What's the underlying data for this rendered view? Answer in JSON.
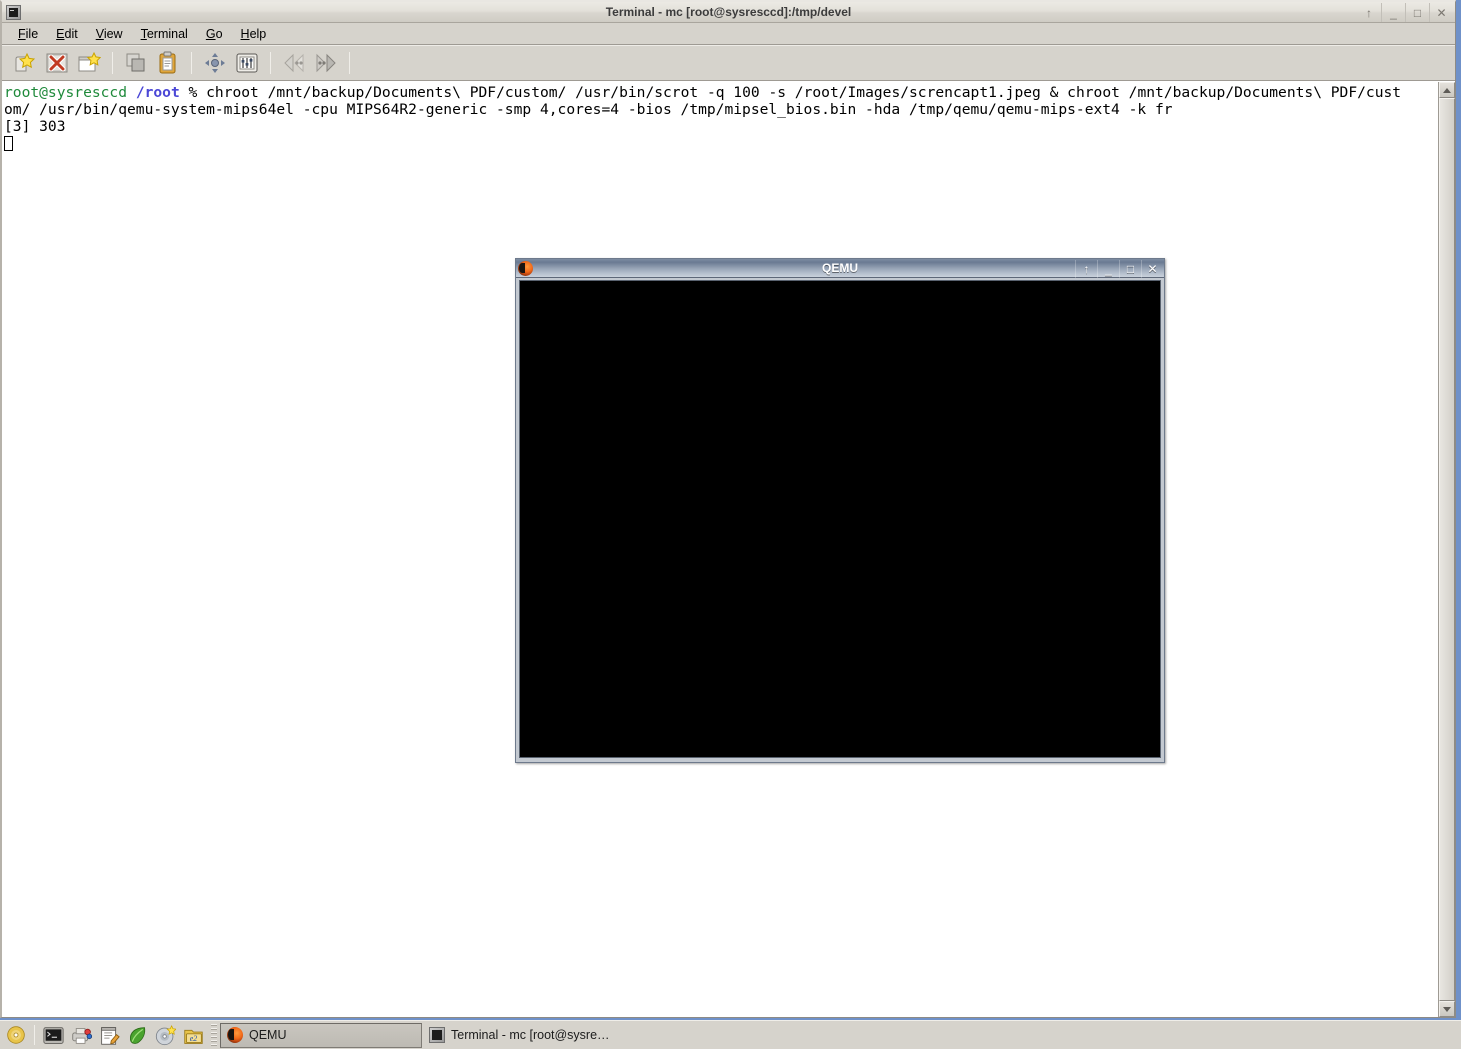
{
  "terminal_window": {
    "title": "Terminal - mc [root@sysresccd]:/tmp/devel",
    "icon": "terminal-icon",
    "window_buttons": [
      {
        "name": "shade-button",
        "glyph": "↑"
      },
      {
        "name": "minimize-button",
        "glyph": "_"
      },
      {
        "name": "maximize-button",
        "glyph": "□"
      },
      {
        "name": "close-button",
        "glyph": "✕"
      }
    ],
    "menu": [
      {
        "label": "File",
        "mnemonic": "F"
      },
      {
        "label": "Edit",
        "mnemonic": "E"
      },
      {
        "label": "View",
        "mnemonic": "V"
      },
      {
        "label": "Terminal",
        "mnemonic": "T"
      },
      {
        "label": "Go",
        "mnemonic": "G"
      },
      {
        "label": "Help",
        "mnemonic": "H"
      }
    ],
    "toolbar": [
      {
        "name": "new-tab-button",
        "icon": "new-tab-star-icon"
      },
      {
        "name": "close-tab-button",
        "icon": "close-tab-x-icon"
      },
      {
        "name": "new-window-button",
        "icon": "new-window-star-icon"
      },
      {
        "name": "separator-1",
        "icon": "separator"
      },
      {
        "name": "copy-button",
        "icon": "copy-icon"
      },
      {
        "name": "paste-button",
        "icon": "clipboard-paste-icon"
      },
      {
        "name": "separator-2",
        "icon": "separator"
      },
      {
        "name": "move-tab-button",
        "icon": "move-arrows-icon"
      },
      {
        "name": "preferences-button",
        "icon": "settings-sliders-icon"
      },
      {
        "name": "separator-3",
        "icon": "separator"
      },
      {
        "name": "previous-tab-button",
        "icon": "back-arrow-icon"
      },
      {
        "name": "next-tab-button",
        "icon": "forward-arrow-icon"
      },
      {
        "name": "separator-4",
        "icon": "separator"
      }
    ],
    "colors": {
      "prompt_user": "#1f8a3b",
      "prompt_path": "#4b47d6",
      "text": "#000000",
      "background": "#ffffff",
      "chrome": "#d6d3cc",
      "desktop": "#6f91c9"
    },
    "console": {
      "prompt_user": "root@sysresccd",
      "prompt_path": "/root",
      "prompt_symbol": "%",
      "command_part1": " chroot /mnt/backup/Documents\\ PDF/custom/ /usr/bin/scrot -q 100 -s /root/Images/screncapt1.jpeg & chroot /mnt/backup/Documents\\ PDF/cust",
      "command_part2": "om/ /usr/bin/qemu-system-mips64el -cpu MIPS64R2-generic -smp 4,cores=4 -bios /tmp/mipsel_bios.bin -hda /tmp/qemu/qemu-mips-ext4 -k fr",
      "job_output": "[3] 303",
      "cursor": "block-cursor"
    },
    "scrollbar": {
      "up_arrow": "scroll-up-arrow",
      "down_arrow": "scroll-down-arrow",
      "thumb": "scroll-thumb"
    }
  },
  "qemu_window": {
    "title": "QEMU",
    "icon": "qemu-icon",
    "screen_state": "blank-black",
    "window_buttons": [
      {
        "name": "shade-button",
        "glyph": "↑"
      },
      {
        "name": "minimize-button",
        "glyph": "_"
      },
      {
        "name": "maximize-button",
        "glyph": "□"
      },
      {
        "name": "close-button",
        "glyph": "✕"
      }
    ]
  },
  "taskbar": {
    "launchers": [
      {
        "name": "sysresccd-menu-button",
        "icon": "yellow-disc-icon"
      },
      {
        "name": "launcher-separator",
        "icon": "separator"
      },
      {
        "name": "launch-terminal-button",
        "icon": "terminal-icon"
      },
      {
        "name": "launch-sysconfig-button",
        "icon": "printer-disk-icon"
      },
      {
        "name": "launch-editor-button",
        "icon": "notepad-pencil-icon"
      },
      {
        "name": "launch-browser-button",
        "icon": "green-leaf-icon"
      },
      {
        "name": "launch-burner-button",
        "icon": "cd-burn-icon"
      },
      {
        "name": "launch-filemanager-button",
        "icon": "e2-folder-icon"
      }
    ],
    "windows": [
      {
        "label": "QEMU",
        "icon": "qemu-icon",
        "active": true
      },
      {
        "label": "Terminal - mc [root@sysre…",
        "icon": "terminal-icon",
        "active": false
      }
    ]
  }
}
